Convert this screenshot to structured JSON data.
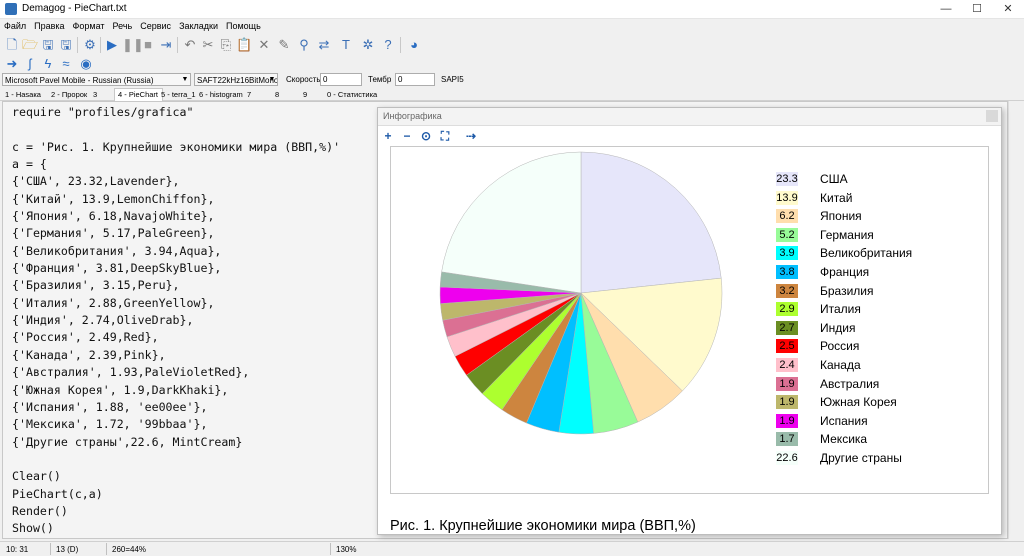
{
  "window": {
    "title": "Demagog - PieChart.txt",
    "min": "—",
    "max": "☐",
    "close": "✕"
  },
  "menu": [
    "Файл",
    "Правка",
    "Формат",
    "Речь",
    "Сервис",
    "Закладки",
    "Помощь"
  ],
  "voice": {
    "voice_name": "Microsoft Pavel Mobile - Russian (Russia)",
    "format": "SAFT22kHz16BitMono",
    "speed_label": "Скорость",
    "speed_value": "0",
    "timbre_label": "Тембр",
    "timbre_value": "0",
    "engine": "SAPI5"
  },
  "tabs": [
    "1 - Наsaка",
    "2 - Пророк",
    "3",
    "4 - PieChart",
    "5 - terra_1",
    "6 - histogram",
    "7",
    "8",
    "9",
    "0 - Статистика"
  ],
  "editor": {
    "code": "require \"profiles/grafica\"\n\nc = 'Рис. 1. Крупнейшие экономики мира (ВВП,%)'\na = {\n{'США', 23.32,Lavender},\n{'Китай', 13.9,LemonChiffon},\n{'Япония', 6.18,NavajoWhite},\n{'Германия', 5.17,PaleGreen},\n{'Великобритания', 3.94,Aqua},\n{'Франция', 3.81,DeepSkyBlue},\n{'Бразилия', 3.15,Peru},\n{'Италия', 2.88,GreenYellow},\n{'Индия', 2.74,OliveDrab},\n{'Россия', 2.49,Red},\n{'Канада', 2.39,Pink},\n{'Австралия', 1.93,PaleVioletRed},\n{'Южная Корея', 1.9,DarkKhaki},\n{'Испания', 1.88, 'ee00ee'},\n{'Мексика', 1.72, '99bbaa'},\n{'Другие страны',22.6, MintCream}\n\nClear()\nPieChart(c,a)\nRender()\nShow()"
  },
  "status": {
    "position": "10: 31",
    "count": "13 (D)",
    "dims": "260=44%",
    "zoom": "130%"
  },
  "infographic": {
    "title": "Инфографика"
  },
  "chart_data": {
    "type": "pie",
    "title": "Рис. 1. Крупнейшие экономики мира (ВВП,%)",
    "labels": [
      "США",
      "Китай",
      "Япония",
      "Германия",
      "Великобритания",
      "Франция",
      "Бразилия",
      "Италия",
      "Индия",
      "Россия",
      "Канада",
      "Австралия",
      "Южная Корея",
      "Испания",
      "Мексика",
      "Другие страны"
    ],
    "values": [
      23.32,
      13.9,
      6.18,
      5.17,
      3.94,
      3.81,
      3.15,
      2.88,
      2.74,
      2.49,
      2.39,
      1.93,
      1.9,
      1.88,
      1.72,
      22.6
    ],
    "display_values": [
      "23.3",
      "13.9",
      "6.2",
      "5.2",
      "3.9",
      "3.8",
      "3.2",
      "2.9",
      "2.7",
      "2.5",
      "2.4",
      "1.9",
      "1.9",
      "1.9",
      "1.7",
      "22.6"
    ],
    "colors": [
      "#e6e6fa",
      "#fffacd",
      "#ffdead",
      "#98fb98",
      "#00ffff",
      "#00bfff",
      "#cd853f",
      "#adff2f",
      "#6b8e23",
      "#ff0000",
      "#ffc0cb",
      "#db7093",
      "#bdb76b",
      "#ee00ee",
      "#99bbaa",
      "#f5fffa"
    ],
    "legend_position": "right"
  }
}
